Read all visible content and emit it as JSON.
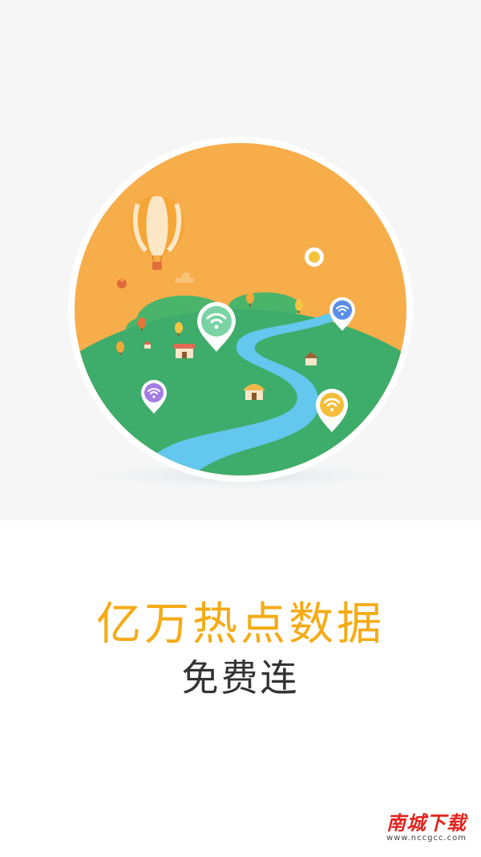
{
  "splash": {
    "headline": "亿万热点数据",
    "subline": "免费连"
  },
  "watermark": {
    "title": "南城下载",
    "url": "www.nccgcc.com"
  },
  "colors": {
    "headline": "#f5ab16",
    "subline": "#333333",
    "sky": "#f8ad4b",
    "ground": "#3eac6a",
    "river": "#63c7ee",
    "pin_green": "#7ad3a4",
    "pin_blue": "#5a8ee8",
    "pin_purple": "#a37de3",
    "pin_yellow": "#f4bd3a",
    "watermark_red": "#e12420",
    "watermark_dark": "#1a1a1a"
  },
  "icons": [
    "hot-air-balloon-icon",
    "wifi-pin-icon",
    "house-icon",
    "tree-icon",
    "bird-icon",
    "sun-icon"
  ]
}
